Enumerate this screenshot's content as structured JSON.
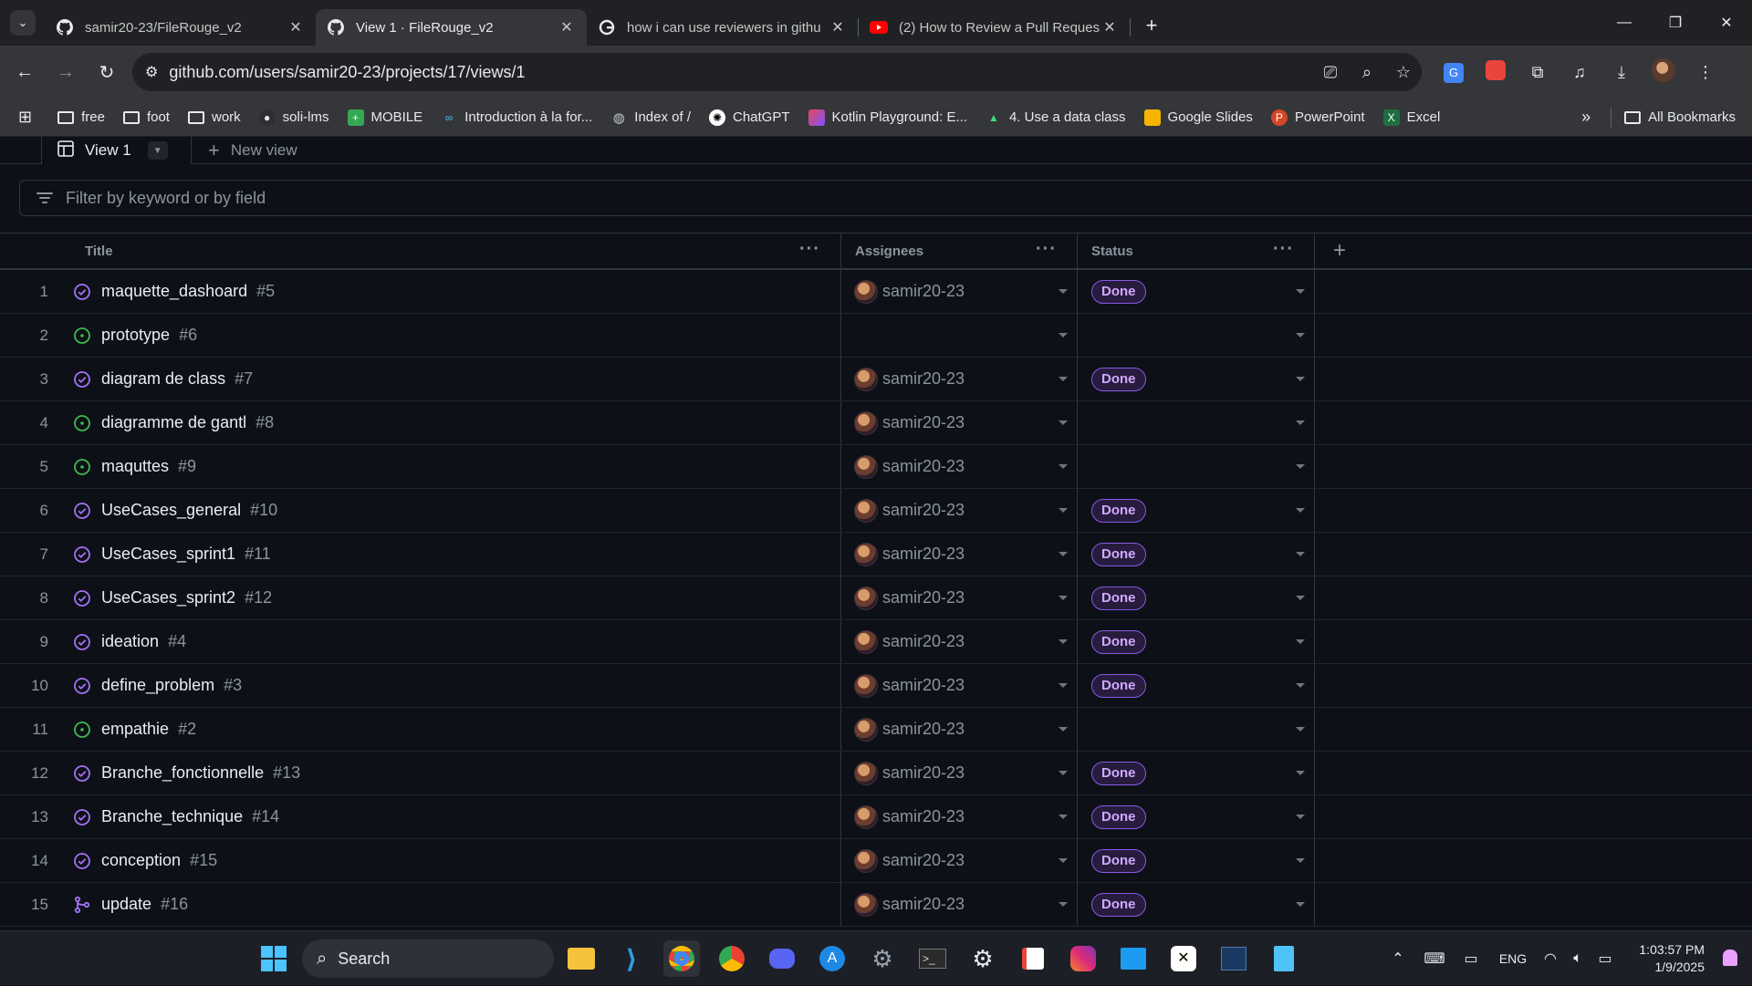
{
  "browser": {
    "tabs": [
      {
        "title": "samir20-23/FileRouge_v2",
        "icon": "github-icon",
        "active": false
      },
      {
        "title": "View 1 · FileRouge_v2",
        "icon": "github-icon",
        "active": true
      },
      {
        "title": "how i can use reviewers in githu",
        "icon": "google-icon",
        "active": false
      },
      {
        "title": "(2) How to Review a Pull Reques",
        "icon": "youtube-icon",
        "active": false
      }
    ],
    "url": "github.com/users/samir20-23/projects/17/views/1",
    "bookmarks": [
      {
        "label": "free",
        "icon": "folder-icon"
      },
      {
        "label": "foot",
        "icon": "folder-icon"
      },
      {
        "label": "work",
        "icon": "folder-icon"
      },
      {
        "label": "soli-lms",
        "icon": "github-icon"
      },
      {
        "label": "MOBILE",
        "icon": "plus-square-icon"
      },
      {
        "label": "Introduction à la for...",
        "icon": "link-icon"
      },
      {
        "label": "Index of /",
        "icon": "globe-icon"
      },
      {
        "label": "ChatGPT",
        "icon": "chatgpt-icon"
      },
      {
        "label": "Kotlin Playground: E...",
        "icon": "kotlin-icon"
      },
      {
        "label": "4. Use a data class",
        "icon": "android-icon"
      },
      {
        "label": "Google Slides",
        "icon": "slides-icon"
      },
      {
        "label": "PowerPoint",
        "icon": "powerpoint-icon"
      },
      {
        "label": "Excel",
        "icon": "excel-icon"
      }
    ],
    "all_bookmarks": "All Bookmarks"
  },
  "project": {
    "view_tab": "View 1",
    "new_view": "New view",
    "filter_placeholder": "Filter by keyword or by field",
    "columns": {
      "title": "Title",
      "assignees": "Assignees",
      "status": "Status"
    },
    "rows": [
      {
        "n": "1",
        "title": "maquette_dashoard",
        "num": "#5",
        "state": "closed",
        "assignee": "samir20-23",
        "status": "Done"
      },
      {
        "n": "2",
        "title": "prototype",
        "num": "#6",
        "state": "open",
        "assignee": "",
        "status": ""
      },
      {
        "n": "3",
        "title": "diagram de class",
        "num": "#7",
        "state": "closed",
        "assignee": "samir20-23",
        "status": "Done"
      },
      {
        "n": "4",
        "title": "diagramme de gantl",
        "num": "#8",
        "state": "open",
        "assignee": "samir20-23",
        "status": ""
      },
      {
        "n": "5",
        "title": "maquttes",
        "num": "#9",
        "state": "open",
        "assignee": "samir20-23",
        "status": ""
      },
      {
        "n": "6",
        "title": "UseCases_general",
        "num": "#10",
        "state": "closed",
        "assignee": "samir20-23",
        "status": "Done"
      },
      {
        "n": "7",
        "title": "UseCases_sprint1",
        "num": "#11",
        "state": "closed",
        "assignee": "samir20-23",
        "status": "Done"
      },
      {
        "n": "8",
        "title": "UseCases_sprint2",
        "num": "#12",
        "state": "closed",
        "assignee": "samir20-23",
        "status": "Done"
      },
      {
        "n": "9",
        "title": "ideation",
        "num": "#4",
        "state": "closed",
        "assignee": "samir20-23",
        "status": "Done"
      },
      {
        "n": "10",
        "title": "define_problem",
        "num": "#3",
        "state": "closed",
        "assignee": "samir20-23",
        "status": "Done"
      },
      {
        "n": "11",
        "title": "empathie",
        "num": "#2",
        "state": "open",
        "assignee": "samir20-23",
        "status": ""
      },
      {
        "n": "12",
        "title": "Branche_fonctionnelle",
        "num": "#13",
        "state": "closed",
        "assignee": "samir20-23",
        "status": "Done"
      },
      {
        "n": "13",
        "title": "Branche_technique",
        "num": "#14",
        "state": "closed",
        "assignee": "samir20-23",
        "status": "Done"
      },
      {
        "n": "14",
        "title": "conception",
        "num": "#15",
        "state": "closed",
        "assignee": "samir20-23",
        "status": "Done"
      },
      {
        "n": "15",
        "title": "update",
        "num": "#16",
        "state": "merged",
        "assignee": "samir20-23",
        "status": "Done"
      }
    ]
  },
  "taskbar": {
    "search": "Search",
    "lang": "ENG",
    "time": "1:03:57 PM",
    "date": "1/9/2025"
  },
  "colors": {
    "done_badge": "#d2a8ff",
    "open_icon": "#3fb950",
    "closed_icon": "#a371f7",
    "page_bg": "#0d1117"
  }
}
